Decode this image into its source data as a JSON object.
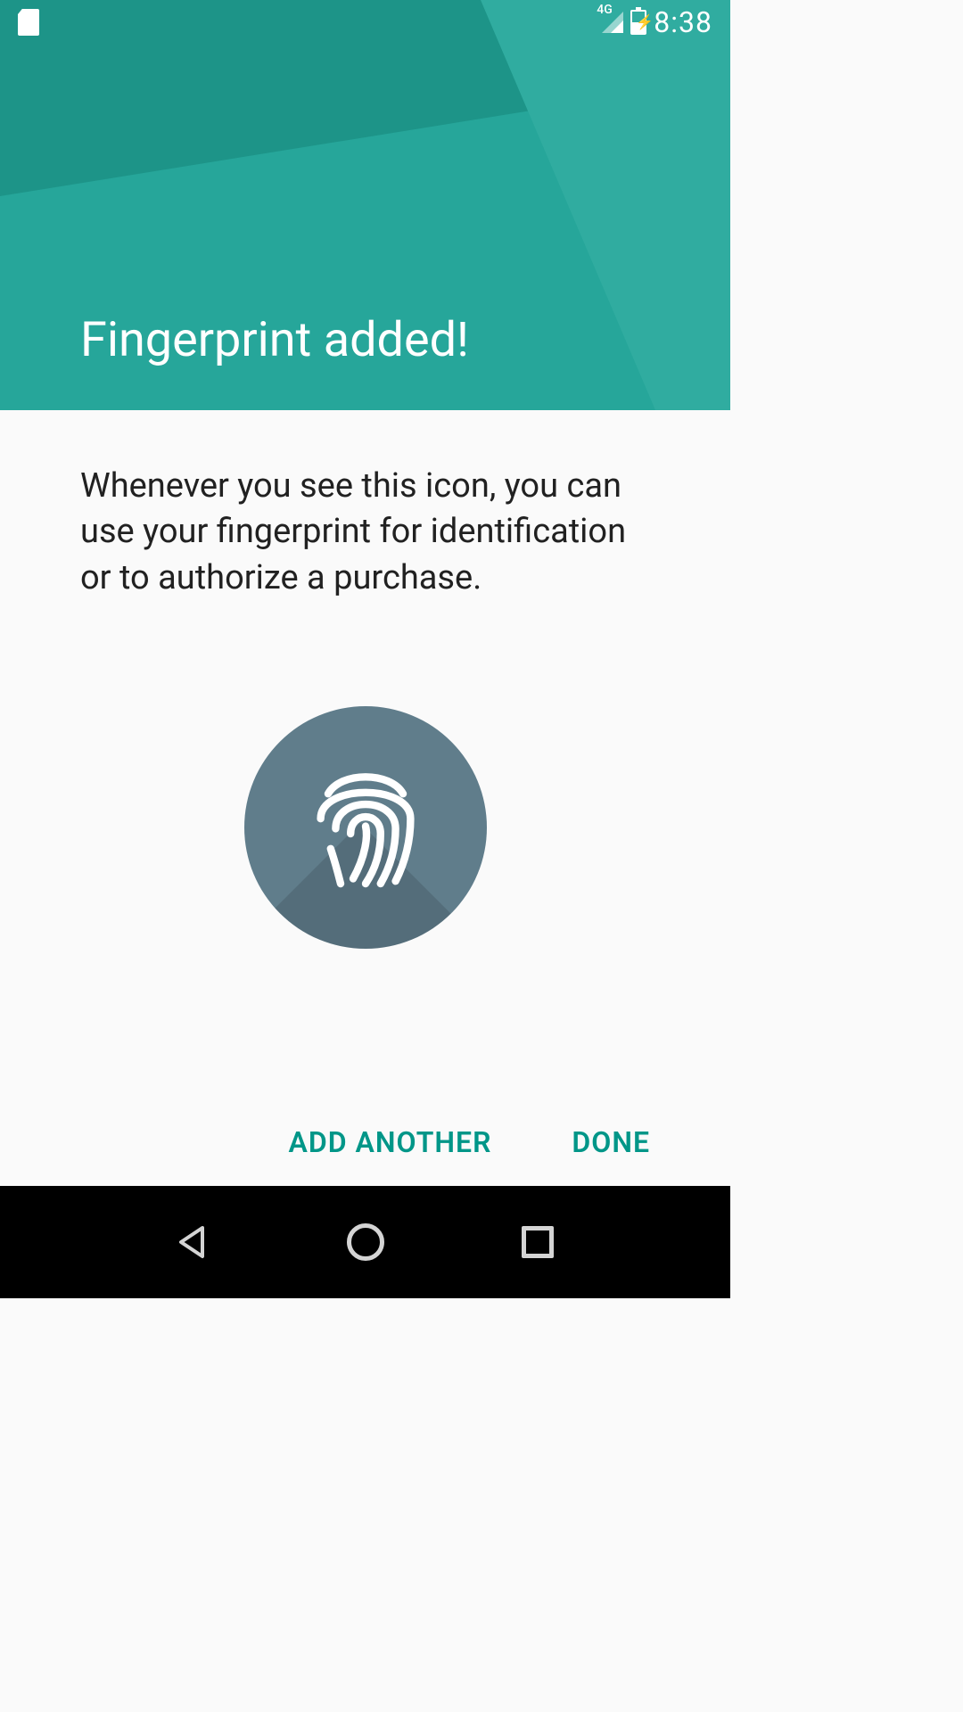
{
  "status_bar": {
    "network_label": "4G",
    "time": "8:38"
  },
  "header": {
    "title": "Fingerprint added!"
  },
  "content": {
    "description": "Whenever you see this icon, you can use your fingerprint for identification or to authorize a purchase."
  },
  "buttons": {
    "add_another": "ADD ANOTHER",
    "done": "DONE"
  },
  "colors": {
    "accent": "#009688",
    "header_bg": "#26a69a",
    "icon_circle": "#607d8b"
  }
}
